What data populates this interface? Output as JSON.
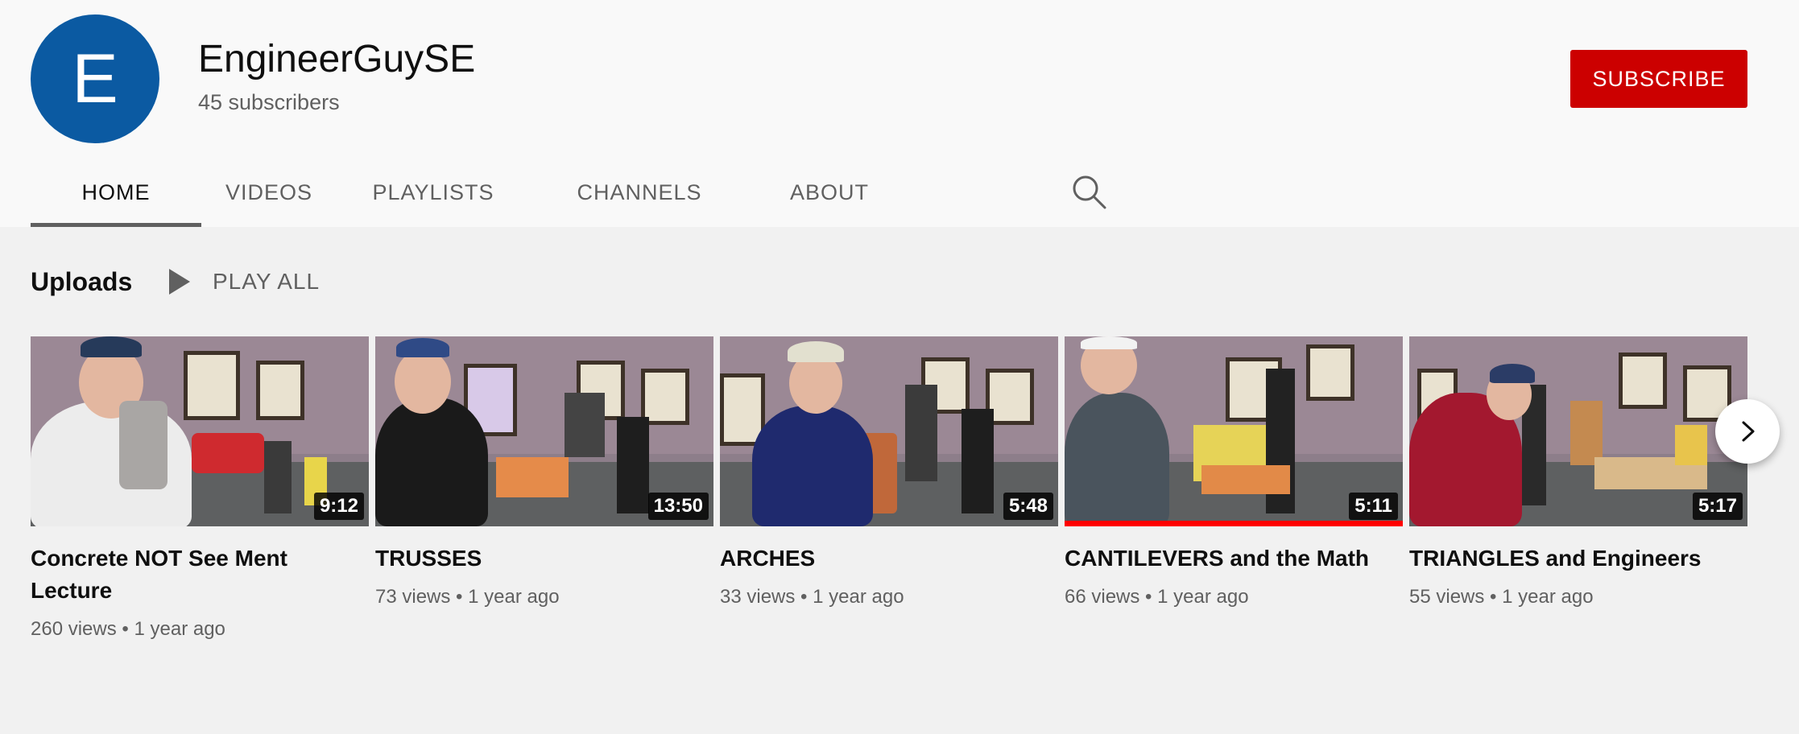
{
  "channel": {
    "avatar_letter": "E",
    "name": "EngineerGuySE",
    "subscribers": "45 subscribers",
    "subscribe_label": "SUBSCRIBE",
    "colors": {
      "avatar_bg": "#0b5aa2",
      "subscribe_bg": "#cc0000"
    }
  },
  "tabs": [
    {
      "label": "HOME",
      "active": true
    },
    {
      "label": "VIDEOS",
      "active": false
    },
    {
      "label": "PLAYLISTS",
      "active": false
    },
    {
      "label": "CHANNELS",
      "active": false
    },
    {
      "label": "ABOUT",
      "active": false
    }
  ],
  "tab_search_icon": "search-icon",
  "uploads": {
    "heading": "Uploads",
    "play_all_label": "PLAY ALL",
    "play_all_icon": "play-icon",
    "next_icon": "chevron-right-icon",
    "videos": [
      {
        "title": "Concrete NOT See Ment Lecture",
        "duration": "9:12",
        "views": "260 views",
        "age": "1 year ago"
      },
      {
        "title": "TRUSSES",
        "duration": "13:50",
        "views": "73 views",
        "age": "1 year ago"
      },
      {
        "title": "ARCHES",
        "duration": "5:48",
        "views": "33 views",
        "age": "1 year ago"
      },
      {
        "title": "CANTILEVERS and the Math",
        "duration": "5:11",
        "views": "66 views",
        "age": "1 year ago",
        "watched_fraction": 1.0
      },
      {
        "title": "TRIANGLES and Engineers",
        "duration": "5:17",
        "views": "55 views",
        "age": "1 year ago"
      }
    ]
  }
}
